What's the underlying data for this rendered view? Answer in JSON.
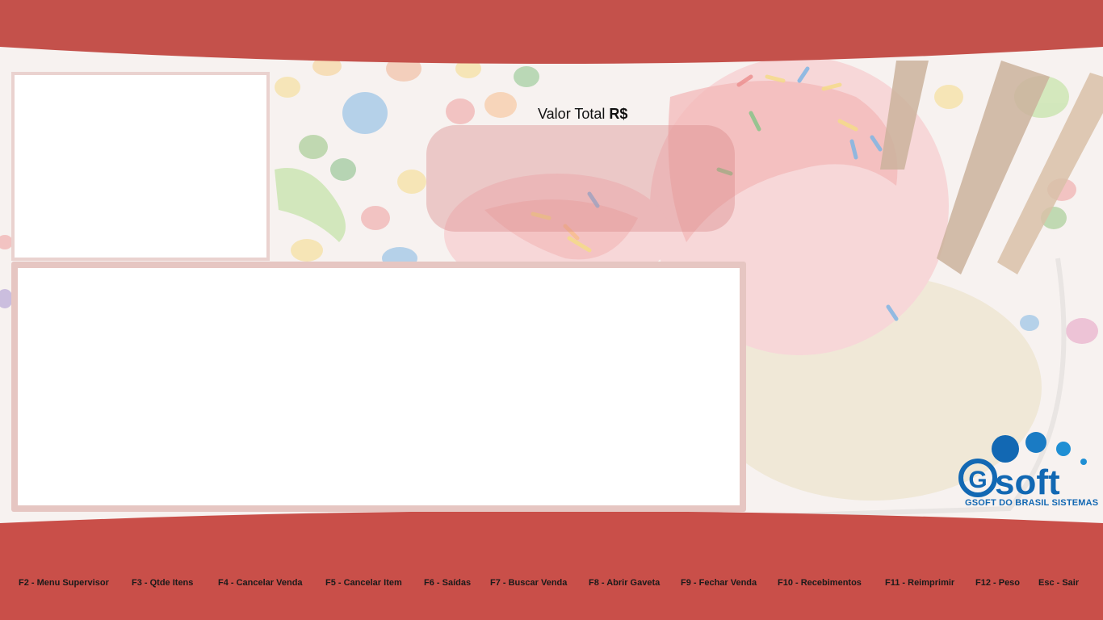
{
  "colors": {
    "band": "#c8534d",
    "panel_border": "#e6c6c2",
    "total_box": "#d88484",
    "logo_blue": "#1268b3"
  },
  "total": {
    "label": "Valor Total",
    "currency": "R$",
    "value": ""
  },
  "logo": {
    "brand": "soft",
    "initial": "G",
    "tagline": "GSOFT DO BRASIL SISTEMAS",
    "icon": "gsoft-bubbles-logo"
  },
  "shortcuts": [
    {
      "label": "F2 - Menu Supervisor"
    },
    {
      "label": "F3 - Qtde Itens"
    },
    {
      "label": "F4 - Cancelar Venda"
    },
    {
      "label": "F5 - Cancelar Item"
    },
    {
      "label": "F6 - Saídas"
    },
    {
      "label": "F7 - Buscar Venda"
    },
    {
      "label": "F8 - Abrir Gaveta"
    },
    {
      "label": "F9 - Fechar Venda"
    },
    {
      "label": "F10 - Recebimentos"
    },
    {
      "label": "F11 - Reimprimir"
    },
    {
      "label": "F12 - Peso"
    },
    {
      "label": "Esc - Sair"
    }
  ]
}
